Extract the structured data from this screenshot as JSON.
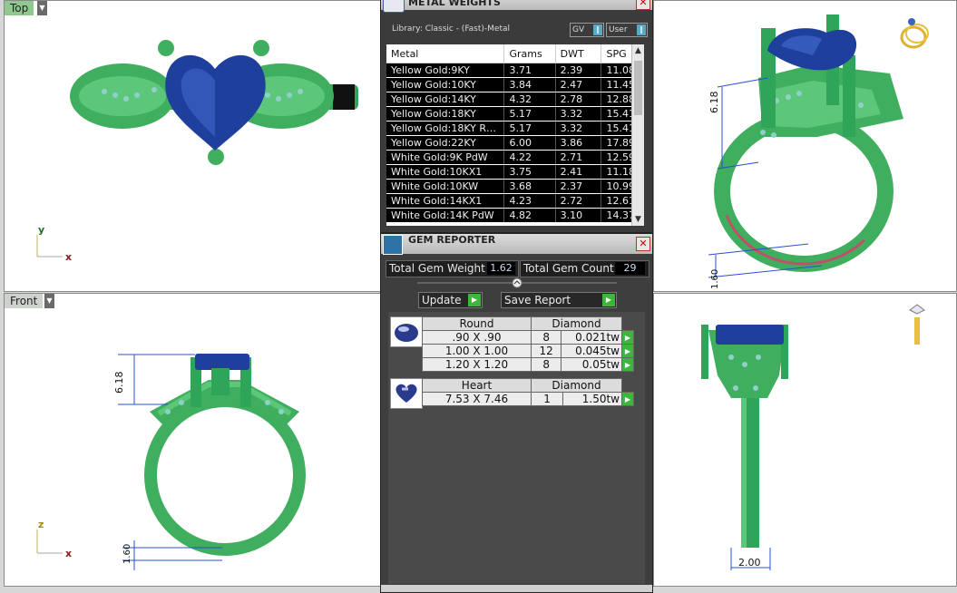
{
  "viewports": {
    "top": {
      "label": "Top",
      "axis_v": "y",
      "axis_h": "x"
    },
    "front": {
      "label": "Front",
      "axis_v": "z",
      "axis_h": "x",
      "dim_height": "6.18",
      "dim_shank": "1.60"
    },
    "perspective": {
      "dim_height": "6.18",
      "dim_base": "1.60"
    },
    "right": {
      "dim_width": "2.00"
    }
  },
  "metal_panel": {
    "title": "METAL WEIGHTS",
    "library": "Library: Classic - (Fast)-Metal",
    "gv_label": "GV",
    "user_label": "User",
    "columns": [
      "Metal",
      "Grams",
      "DWT",
      "SPG"
    ],
    "rows": [
      [
        "Yellow Gold:9KY",
        "3.71",
        "2.39",
        "11.08"
      ],
      [
        "Yellow Gold:10KY",
        "3.84",
        "2.47",
        "11.45"
      ],
      [
        "Yellow Gold:14KY",
        "4.32",
        "2.78",
        "12.88"
      ],
      [
        "Yellow Gold:18KY",
        "5.17",
        "3.32",
        "15.41"
      ],
      [
        "Yellow Gold:18KY R…",
        "5.17",
        "3.32",
        "15.41"
      ],
      [
        "Yellow Gold:22KY",
        "6.00",
        "3.86",
        "17.89"
      ],
      [
        "White Gold:9K PdW",
        "4.22",
        "2.71",
        "12.59"
      ],
      [
        "White Gold:10KX1",
        "3.75",
        "2.41",
        "11.18"
      ],
      [
        "White Gold:10KW",
        "3.68",
        "2.37",
        "10.99"
      ],
      [
        "White Gold:14KX1",
        "4.23",
        "2.72",
        "12.61"
      ],
      [
        "White Gold:14K PdW",
        "4.82",
        "3.10",
        "14.37"
      ]
    ]
  },
  "gem_reporter": {
    "title": "GEM REPORTER",
    "total_weight_label": "Total Gem Weight",
    "total_weight": "1.62",
    "total_count_label": "Total Gem Count",
    "total_count": "29",
    "update_label": "Update",
    "save_label": "Save Report",
    "groups": [
      {
        "shape": "Round",
        "material": "Diamond",
        "rows": [
          [
            ".90 X .90",
            "8",
            "0.021tw"
          ],
          [
            "1.00 X 1.00",
            "12",
            "0.045tw"
          ],
          [
            "1.20 X 1.20",
            "8",
            "0.05tw"
          ]
        ]
      },
      {
        "shape": "Heart",
        "material": "Diamond",
        "rows": [
          [
            "7.53 X 7.46",
            "1",
            "1.50tw"
          ]
        ]
      }
    ]
  },
  "colors": {
    "metal": "#3fae5e",
    "gem": "#1f3f9c",
    "gem_light": "#3a62c4",
    "accent": "#3cb63c"
  }
}
